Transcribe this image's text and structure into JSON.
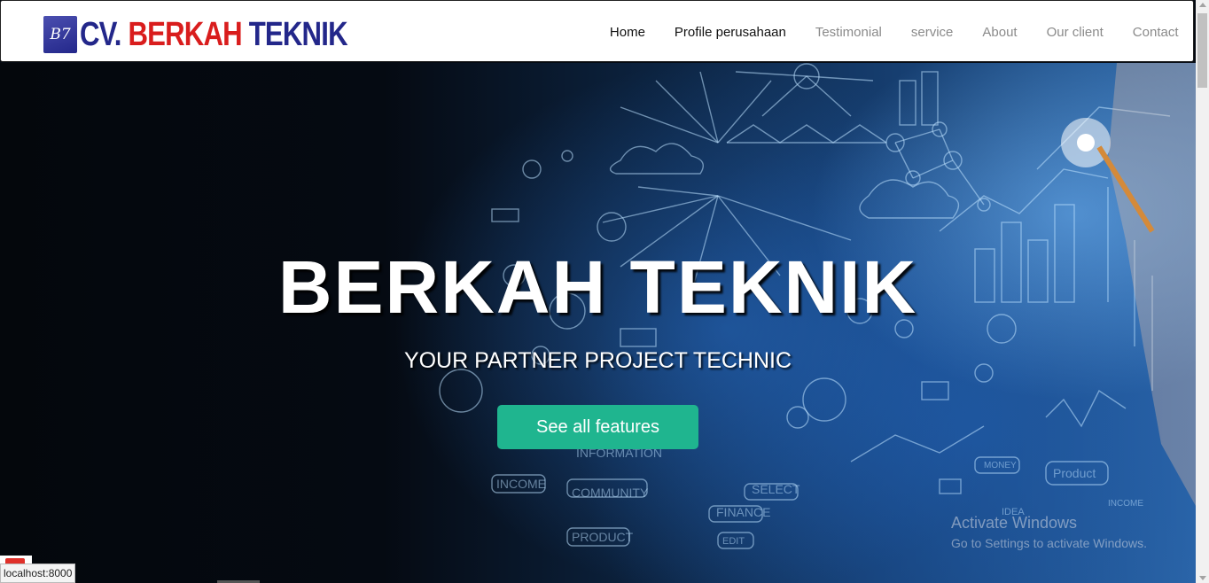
{
  "brand": {
    "logo_mark": "B7",
    "cv": "CV.",
    "berkah": "BERKAH",
    "teknik": "TEKNIK"
  },
  "nav": {
    "items": [
      {
        "label": "Home"
      },
      {
        "label": "Profile perusahaan"
      },
      {
        "label": "Testimonial"
      },
      {
        "label": "service"
      },
      {
        "label": "About"
      },
      {
        "label": "Our client"
      },
      {
        "label": "Contact"
      }
    ]
  },
  "hero": {
    "title": "BERKAH TEKNIK",
    "subtitle": "YOUR PARTNER PROJECT TECHNIC",
    "cta_label": "See all features",
    "art_words": [
      "INFORMATION",
      "COMMUNITY",
      "INCOME",
      "PRODUCT",
      "FINANCE",
      "SELECT",
      "Product",
      "MONEY",
      "IDEA",
      "EDIT",
      "INCOME"
    ]
  },
  "watermark": {
    "line1": "Activate Windows",
    "line2": "Go to Settings to activate Windows."
  },
  "status_bar": {
    "url": "localhost:8000"
  },
  "colors": {
    "accent": "#1fb58f",
    "brand_blue": "#23278a",
    "brand_red": "#d91d1d"
  }
}
